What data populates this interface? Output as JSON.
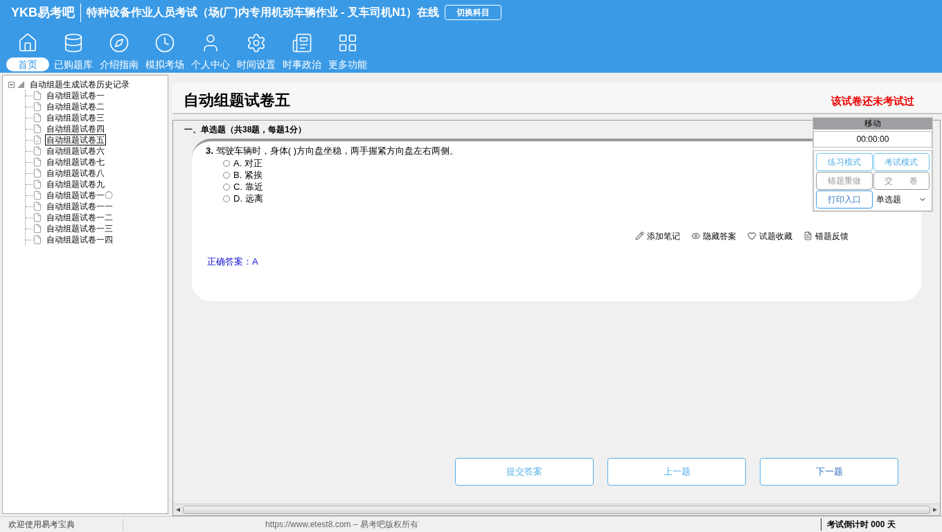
{
  "header": {
    "logo": "YKB易考吧",
    "title": "特种设备作业人员考试（场(厂)内专用机动车辆作业 - 叉车司机N1）在线",
    "switch_button": "切换科目"
  },
  "nav": [
    {
      "label": "首页",
      "selected": true
    },
    {
      "label": "已购题库",
      "selected": false
    },
    {
      "label": "介绍指南",
      "selected": false
    },
    {
      "label": "模拟考场",
      "selected": false
    },
    {
      "label": "个人中心",
      "selected": false
    },
    {
      "label": "时间设置",
      "selected": false
    },
    {
      "label": "时事政治",
      "selected": false
    },
    {
      "label": "更多功能",
      "selected": false
    }
  ],
  "tree": {
    "label": "自动组题生成试卷历史记录",
    "expanded": true,
    "children": [
      {
        "label": "自动组题试卷一",
        "selected": false
      },
      {
        "label": "自动组题试卷二",
        "selected": false
      },
      {
        "label": "自动组题试卷三",
        "selected": false
      },
      {
        "label": "自动组题试卷四",
        "selected": false
      },
      {
        "label": "自动组题试卷五",
        "selected": true
      },
      {
        "label": "自动组题试卷六",
        "selected": false
      },
      {
        "label": "自动组题试卷七",
        "selected": false
      },
      {
        "label": "自动组题试卷八",
        "selected": false
      },
      {
        "label": "自动组题试卷九",
        "selected": false
      },
      {
        "label": "自动组题试卷一〇",
        "selected": false
      },
      {
        "label": "自动组题试卷一一",
        "selected": false
      },
      {
        "label": "自动组题试卷一二",
        "selected": false
      },
      {
        "label": "自动组题试卷一三",
        "selected": false
      },
      {
        "label": "自动组题试卷一四",
        "selected": false
      }
    ]
  },
  "paper": {
    "title": "自动组题试卷五",
    "status": "该试卷还未考试过",
    "section": "一、单选题（共38题，每题1分）"
  },
  "question": {
    "number": "3.",
    "text": "驾驶车辆时，身体( )方向盘坐稳，两手握紧方向盘左右两侧。",
    "options": [
      {
        "label": "A. 对正",
        "selected": false
      },
      {
        "label": "B. 紧挨",
        "selected": false
      },
      {
        "label": "C. 靠近",
        "selected": false
      },
      {
        "label": "D. 远离",
        "selected": false
      }
    ],
    "actions": [
      "添加笔记",
      "隐藏答案",
      "试题收藏",
      "错题反馈"
    ],
    "answer": "正确答案：A"
  },
  "bottom_buttons": [
    "提交答案",
    "上一题",
    "下一题"
  ],
  "control_panel": {
    "title": "移动",
    "timer": "00:00:00",
    "buttons": [
      {
        "label": "练习模式",
        "disabled": false
      },
      {
        "label": "考试模式",
        "disabled": false
      },
      {
        "label": "错题重做",
        "disabled": true
      },
      {
        "label": "交　　卷",
        "disabled": true
      },
      {
        "label": "打印入口",
        "disabled": false
      }
    ],
    "type_select": "单选题"
  },
  "status_bar": {
    "welcome": "欢迎使用易考宝典",
    "copyright": "https://www.etest8.com – 易考吧版权所有",
    "countdown": "考试倒计时 000 天"
  }
}
